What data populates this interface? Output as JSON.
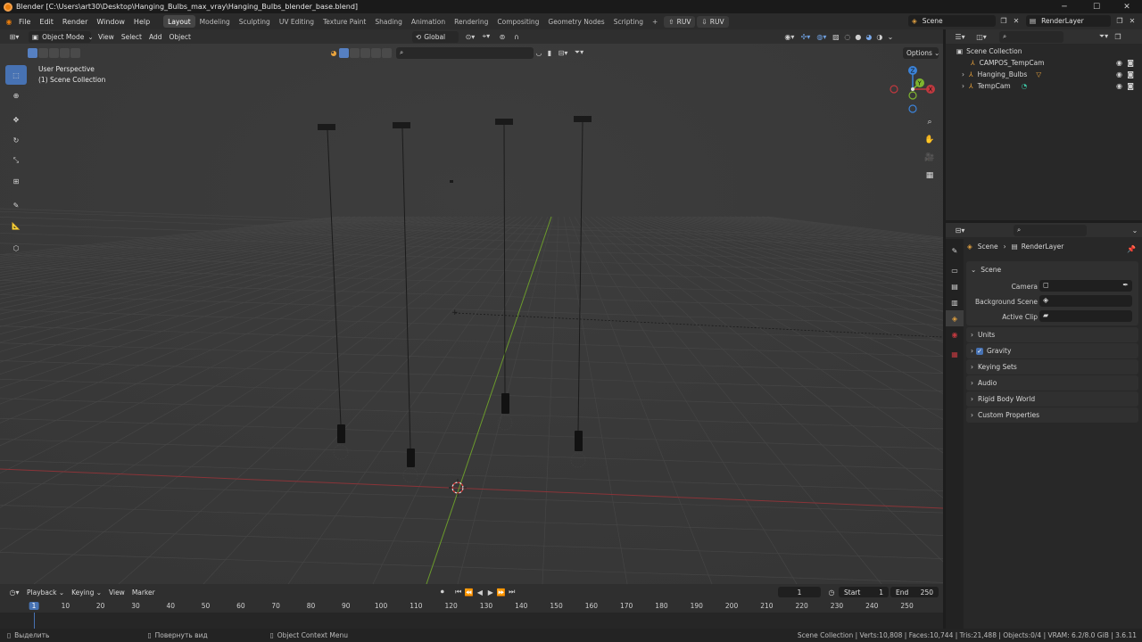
{
  "titlebar": {
    "title": "Blender [C:\\Users\\art30\\Desktop\\Hanging_Bulbs_max_vray\\Hanging_Bulbs_blender_base.blend]",
    "minimize": "─",
    "maximize": "☐",
    "close": "✕"
  },
  "menu": [
    "File",
    "Edit",
    "Render",
    "Window",
    "Help"
  ],
  "workspaces": [
    "Layout",
    "Modeling",
    "Sculpting",
    "UV Editing",
    "Texture Paint",
    "Shading",
    "Animation",
    "Rendering",
    "Compositing",
    "Geometry Nodes",
    "Scripting"
  ],
  "active_workspace": "Layout",
  "add_workspace": "+",
  "ruv_buttons": [
    "RUV",
    "RUV"
  ],
  "scene_selector": "Scene",
  "renderlayer_selector": "RenderLayer",
  "viewport": {
    "mode": "Object Mode",
    "menus": [
      "View",
      "Select",
      "Add",
      "Object"
    ],
    "orientation": "Global",
    "view_name": "User Perspective",
    "collection_name": "(1) Scene Collection",
    "options": "Options",
    "gizmo_axes": [
      "X",
      "Y",
      "Z"
    ]
  },
  "outliner": {
    "root": "Scene Collection",
    "items": [
      {
        "name": "CAMPOS_TempCam"
      },
      {
        "name": "Hanging_Bulbs"
      },
      {
        "name": "TempCam"
      }
    ]
  },
  "properties": {
    "breadcrumb_scene": "Scene",
    "breadcrumb_layer": "RenderLayer",
    "panel_title": "Scene",
    "fields": [
      {
        "label": "Camera"
      },
      {
        "label": "Background Scene"
      },
      {
        "label": "Active Clip"
      }
    ],
    "sections": [
      "Units",
      "Gravity",
      "Keying Sets",
      "Audio",
      "Rigid Body World",
      "Custom Properties"
    ],
    "gravity_checked": true
  },
  "timeline": {
    "menus": [
      "Playback",
      "Keying",
      "View",
      "Marker"
    ],
    "current_frame": "1",
    "start_label": "Start",
    "start_value": "1",
    "end_label": "End",
    "end_value": "250",
    "ruler": [
      "1",
      "10",
      "20",
      "30",
      "40",
      "50",
      "60",
      "70",
      "80",
      "90",
      "100",
      "110",
      "120",
      "130",
      "140",
      "150",
      "160",
      "170",
      "180",
      "190",
      "200",
      "210",
      "220",
      "230",
      "240",
      "250"
    ]
  },
  "statusbar": {
    "select": "Выделить",
    "rotate": "Повернуть вид",
    "context": "Object Context Menu",
    "stats": "Scene Collection | Verts:10,808 | Faces:10,744 | Tris:21,488 | Objects:0/4 | VRAM: 6.2/8.0 GiB | 3.6.11"
  },
  "colors": {
    "accent": "#4772b3",
    "x_axis": "#c0393f",
    "y_axis": "#7eb42f",
    "z_axis": "#3b83d9",
    "viewport_bg": "#393939"
  }
}
